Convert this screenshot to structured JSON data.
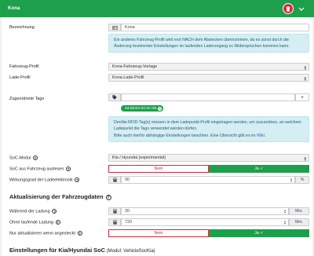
{
  "header": {
    "title": "Kona"
  },
  "bezeichnung": {
    "label": "Bezeichnung",
    "value": "Kona"
  },
  "info_profile": "Ein anderes Fahrzeug-Profil wird erst NACH dem Abstecken übernommen, da es sonst durch die Änderung bestimmter Einstellungen im laufenden Ladevorgang zu Widersprüchen kommen kann.",
  "vehicle_profile": {
    "label": "Fahrzeug-Profil",
    "value": "Kona-Fahrzeug-Vorlage"
  },
  "charge_profile": {
    "label": "Lade-Profil",
    "value": "Kona-Lade-Profil"
  },
  "tags": {
    "label": "Zugeordnete Tags",
    "add": "+",
    "chip": "04:08:E1:02:3A:4B"
  },
  "info_tags": {
    "line1": "Der/die RFID-Tag(s) müssen in dem Ladepunkt-Profil eingetragen werden, um zuzuordnen, an welchem Ladepunkt die Tags verwendet werden dürfen.",
    "line2": "Bitte auch hierfür abhängige Einstellungen beachten. Eine Übersicht gibt es im ",
    "link": "Wiki",
    "end": "."
  },
  "soc_module": {
    "label": "SoC-Modul",
    "value": "Kia / Hyundai (experimental)"
  },
  "soc_read": {
    "label": "SoC aus Fahrzeug auslesen",
    "no": "Nein",
    "yes": "Ja"
  },
  "efficiency": {
    "label": "Wirkungsgrad der Ladeelektronik",
    "value": "90",
    "unit": "%"
  },
  "section_update": "Aktualisierung der Fahrzeugdaten",
  "during_charge": {
    "label": "Während der Ladung",
    "value": "30",
    "unit": "Min."
  },
  "without_charge": {
    "label": "Ohne laufende Ladung",
    "value": "720",
    "unit": "Min."
  },
  "only_plugged": {
    "label": "Nur aktualisieren wenn angesteckt",
    "no": "Nein",
    "yes": "Ja"
  },
  "section_kia": {
    "bold": "Einstellungen für Kia/Hyundai SoC",
    "normal": " (Modul: VehicleSocKia)"
  },
  "colors": {
    "header": "#1e9f4b",
    "danger": "#d72a3a",
    "info_bg": "#d5eef3"
  }
}
